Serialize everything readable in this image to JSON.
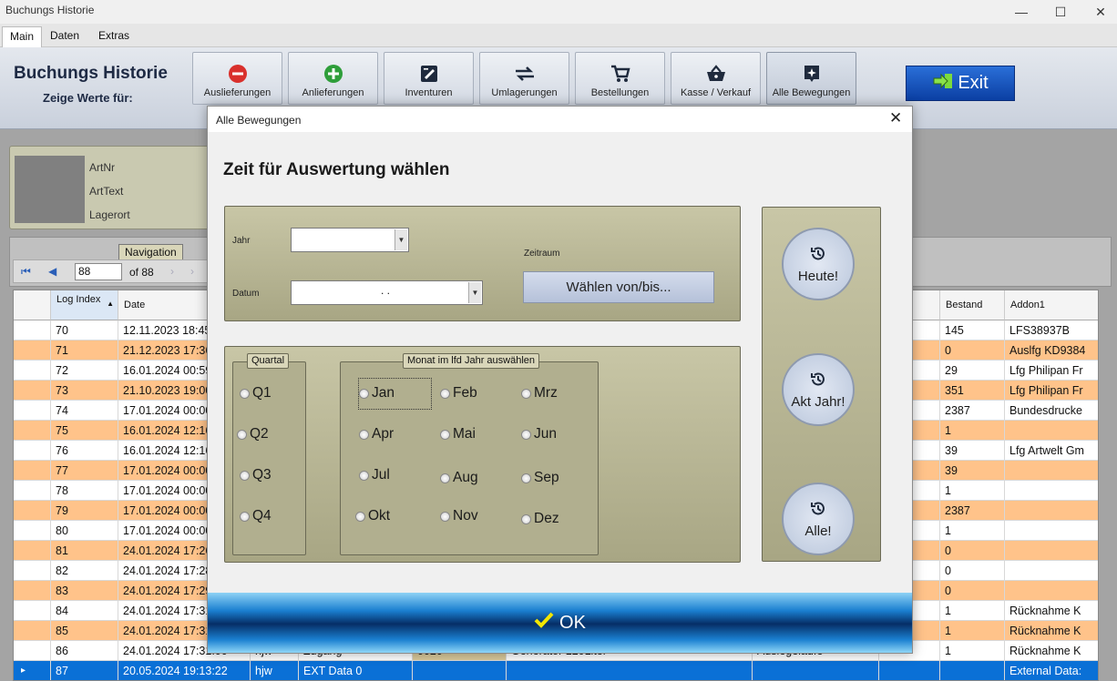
{
  "window": {
    "title": "Buchungs Historie",
    "min": "—",
    "max": "☐",
    "close": "✕"
  },
  "tabs": [
    "Main",
    "Daten",
    "Extras"
  ],
  "ribbon": {
    "title": "Buchungs Historie",
    "subtitle": "Zeige Werte für:",
    "buttons": [
      "Auslieferungen",
      "Anlieferungen",
      "Inventuren",
      "Umlagerungen",
      "Bestellungen",
      "Kasse / Verkauf",
      "Alle Bewegungen"
    ],
    "exit": "Exit",
    "colors": {
      "auslieferungen_icon": "#d9302c",
      "anlieferungen_icon": "#2e9e3a",
      "exit_bg": "#0b3fa3"
    }
  },
  "info": {
    "artnr": "ArtNr",
    "arttext": "ArtText",
    "lagerort": "Lagerort"
  },
  "navigation": {
    "legend": "Navigation",
    "position": "88",
    "of": "of 88"
  },
  "grid": {
    "headers": {
      "log_index": "Log Index",
      "date": "Date",
      "bestand": "Bestand",
      "addon1": "Addon1",
      "partial": "e"
    },
    "rows": [
      {
        "idx": "70",
        "date": "12.11.2023 18:45",
        "bestand": "145",
        "addon": "LFS38937B"
      },
      {
        "idx": "71",
        "date": "21.12.2023 17:36",
        "bestand": "0",
        "addon": "Auslfg KD9384"
      },
      {
        "idx": "72",
        "date": "16.01.2024 00:59",
        "bestand": "29",
        "addon": "Lfg Philipan Fr"
      },
      {
        "idx": "73",
        "date": "21.10.2023 19:00",
        "bestand": "351",
        "addon": "Lfg Philipan Fr"
      },
      {
        "idx": "74",
        "date": "17.01.2024 00:00",
        "bestand": "2387",
        "addon": "Bundesdrucke"
      },
      {
        "idx": "75",
        "date": "16.01.2024 12:16",
        "bestand": "1",
        "addon": ""
      },
      {
        "idx": "76",
        "date": "16.01.2024 12:16",
        "bestand": "39",
        "addon": "Lfg Artwelt Gm"
      },
      {
        "idx": "77",
        "date": "17.01.2024 00:00",
        "bestand": "39",
        "addon": ""
      },
      {
        "idx": "78",
        "date": "17.01.2024 00:00",
        "bestand": "1",
        "addon": ""
      },
      {
        "idx": "79",
        "date": "17.01.2024 00:00",
        "bestand": "2387",
        "addon": ""
      },
      {
        "idx": "80",
        "date": "17.01.2024 00:00",
        "bestand": "1",
        "addon": ""
      },
      {
        "idx": "81",
        "date": "24.01.2024 17:26",
        "bestand": "0",
        "addon": ""
      },
      {
        "idx": "82",
        "date": "24.01.2024 17:28",
        "bestand": "0",
        "addon": ""
      },
      {
        "idx": "83",
        "date": "24.01.2024 17:29",
        "bestand": "0",
        "addon": ""
      },
      {
        "idx": "84",
        "date": "24.01.2024 17:31",
        "bestand": "1",
        "addon": "Rücknahme K"
      },
      {
        "idx": "85",
        "date": "24.01.2024 17:31",
        "bestand": "1",
        "addon": "Rücknahme K"
      },
      {
        "idx": "86",
        "date": "24.01.2024 17:31:00",
        "user": "hjw",
        "typ": "Zugang",
        "code": "0020",
        "text": "Generator 120Liter",
        "ort": "Auslegelaufe",
        "bestand": "1",
        "addon": "Rücknahme K"
      }
    ],
    "selected": {
      "idx": "87",
      "date": "20.05.2024 19:13:22",
      "user": "hjw",
      "typ": "EXT Data 0",
      "addon": "External Data:"
    }
  },
  "dialog": {
    "title": "Alle Bewegungen",
    "heading": "Zeit für Auswertung wählen",
    "jahr_label": "Jahr",
    "datum_label": "Datum",
    "datum_value": ". .",
    "zeitraum_label": "Zeitraum",
    "waehlen_button": "Wählen von/bis...",
    "quartal_legend": "Quartal",
    "quartale": [
      "Q1",
      "Q2",
      "Q3",
      "Q4"
    ],
    "monat_legend": "Monat im lfd Jahr auswählen",
    "monate": [
      "Jan",
      "Feb",
      "Mrz",
      "Apr",
      "Mai",
      "Jun",
      "Jul",
      "Aug",
      "Sep",
      "Okt",
      "Nov",
      "Dez"
    ],
    "heute": "Heute!",
    "akt_jahr": "Akt Jahr!",
    "alle": "Alle!",
    "ok": "OK",
    "colors": {
      "panel": "#b8b694",
      "ok_check": "#f2e600"
    }
  }
}
